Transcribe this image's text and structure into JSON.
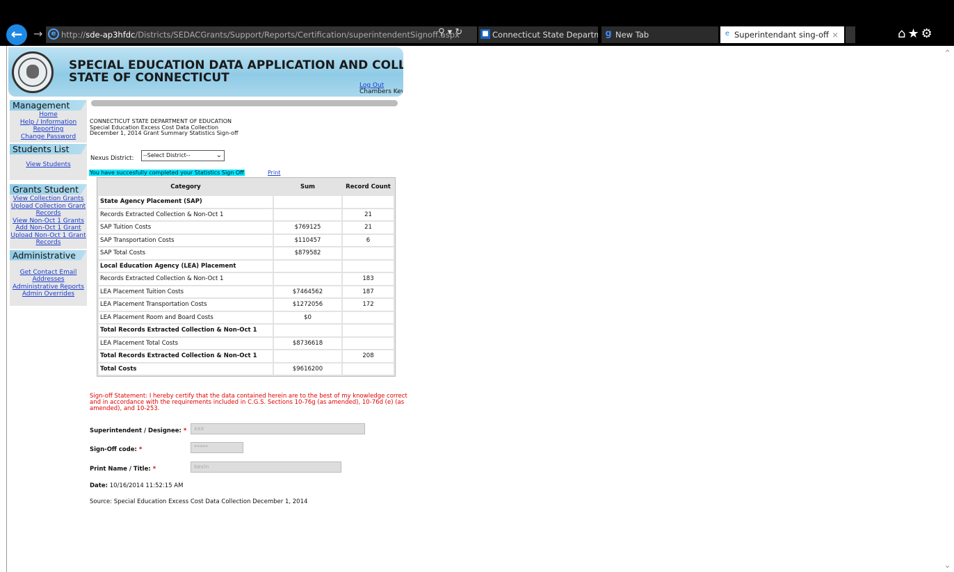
{
  "browser": {
    "url_prefix": "http://",
    "url_host": "sde-ap3hfdc",
    "url_path": "/Districts/SEDACGrants/Support/Reports/Certification/superintendentSignoff.aspx",
    "tabs": [
      {
        "label": "Connecticut State Department ..."
      },
      {
        "label": "New Tab"
      },
      {
        "label": "Superintendant sing-off"
      }
    ]
  },
  "banner": {
    "line1": "SPECIAL EDUCATION DATA APPLICATION AND COLLECTION",
    "line2": "STATE OF CONNECTICUT",
    "logout": "Log Out",
    "user": "Chambers Kevin"
  },
  "sidebar": {
    "management": {
      "title": "Management",
      "items": [
        "Home",
        "Help / Information",
        "Reporting",
        "Change Password"
      ]
    },
    "students": {
      "title": "Students List",
      "items": [
        "View Students"
      ]
    },
    "grants": {
      "title": "Grants Student",
      "items": [
        "View Collection Grants",
        "Upload Collection Grant Records",
        "View Non-Oct 1 Grants",
        "Add Non-Oct 1 Grant",
        "Upload Non-Oct 1 Grant Records"
      ]
    },
    "admin": {
      "title": "Administrative",
      "items": [
        "Get Contact Email Addresses",
        "Administrative Reports",
        "Admin Overrides"
      ]
    }
  },
  "header": {
    "line1": "CONNECTICUT STATE DEPARTMENT OF EDUCATION",
    "line2": "Special Education Excess Cost Data Collection",
    "line3": "December 1, 2014 Grant Summary Statistics Sign-off"
  },
  "district": {
    "label": "Nexus District:",
    "selected": "--Select District--"
  },
  "success_message": "You have succesfully completed your Statistics Sign Off",
  "print_label": "Print",
  "grid": {
    "headers": [
      "Category",
      "Sum",
      "Record Count"
    ],
    "rows": [
      {
        "category": "State Agency Placement (SAP)",
        "sum": "",
        "count": "",
        "bold": true
      },
      {
        "category": "Records Extracted Collection & Non-Oct 1",
        "sum": "",
        "count": "21",
        "bold": false
      },
      {
        "category": "SAP Tuition Costs",
        "sum": "$769125",
        "count": "21",
        "bold": false
      },
      {
        "category": "SAP Transportation Costs",
        "sum": "$110457",
        "count": "6",
        "bold": false
      },
      {
        "category": "SAP Total Costs",
        "sum": "$879582",
        "count": "",
        "bold": false
      },
      {
        "category": "Local Education Agency (LEA) Placement",
        "sum": "",
        "count": "",
        "bold": true
      },
      {
        "category": "Records Extracted Collection & Non-Oct 1",
        "sum": "",
        "count": "183",
        "bold": false
      },
      {
        "category": "LEA Placement Tuition Costs",
        "sum": "$7464562",
        "count": "187",
        "bold": false
      },
      {
        "category": "LEA Placement Transportation Costs",
        "sum": "$1272056",
        "count": "172",
        "bold": false
      },
      {
        "category": "LEA Placement Room and Board Costs",
        "sum": "$0",
        "count": "",
        "bold": false
      },
      {
        "category": "Total Records Extracted Collection & Non-Oct 1",
        "sum": "",
        "count": "",
        "bold": true
      },
      {
        "category": "LEA Placement Total Costs",
        "sum": "$8736618",
        "count": "",
        "bold": false
      },
      {
        "category": "Total Records Extracted Collection & Non-Oct 1",
        "sum": "",
        "count": "208",
        "bold": true
      },
      {
        "category": "Total Costs",
        "sum": "$9616200",
        "count": "",
        "bold": true
      }
    ]
  },
  "statement": "Sign-off Statement: I hereby certify that the data contained herein are to the best of my knowledge correct and in accordance with the requirements included in C.G.S. Sections 10-76g (as amended), 10-76d (e) (as amended), and 10-253.",
  "form": {
    "superintendent_label": "Superintendent / Designee:",
    "superintendent_value": "xxx",
    "signoff_label": "Sign-Off code:",
    "signoff_value": "*****",
    "printname_label": "Print Name / Title:",
    "printname_value": "kevin",
    "required_mark": "*"
  },
  "date_label": "Date:",
  "date_value": "10/16/2014 11:52:15 AM",
  "source": "Source: Special Education Excess Cost Data Collection December 1, 2014"
}
